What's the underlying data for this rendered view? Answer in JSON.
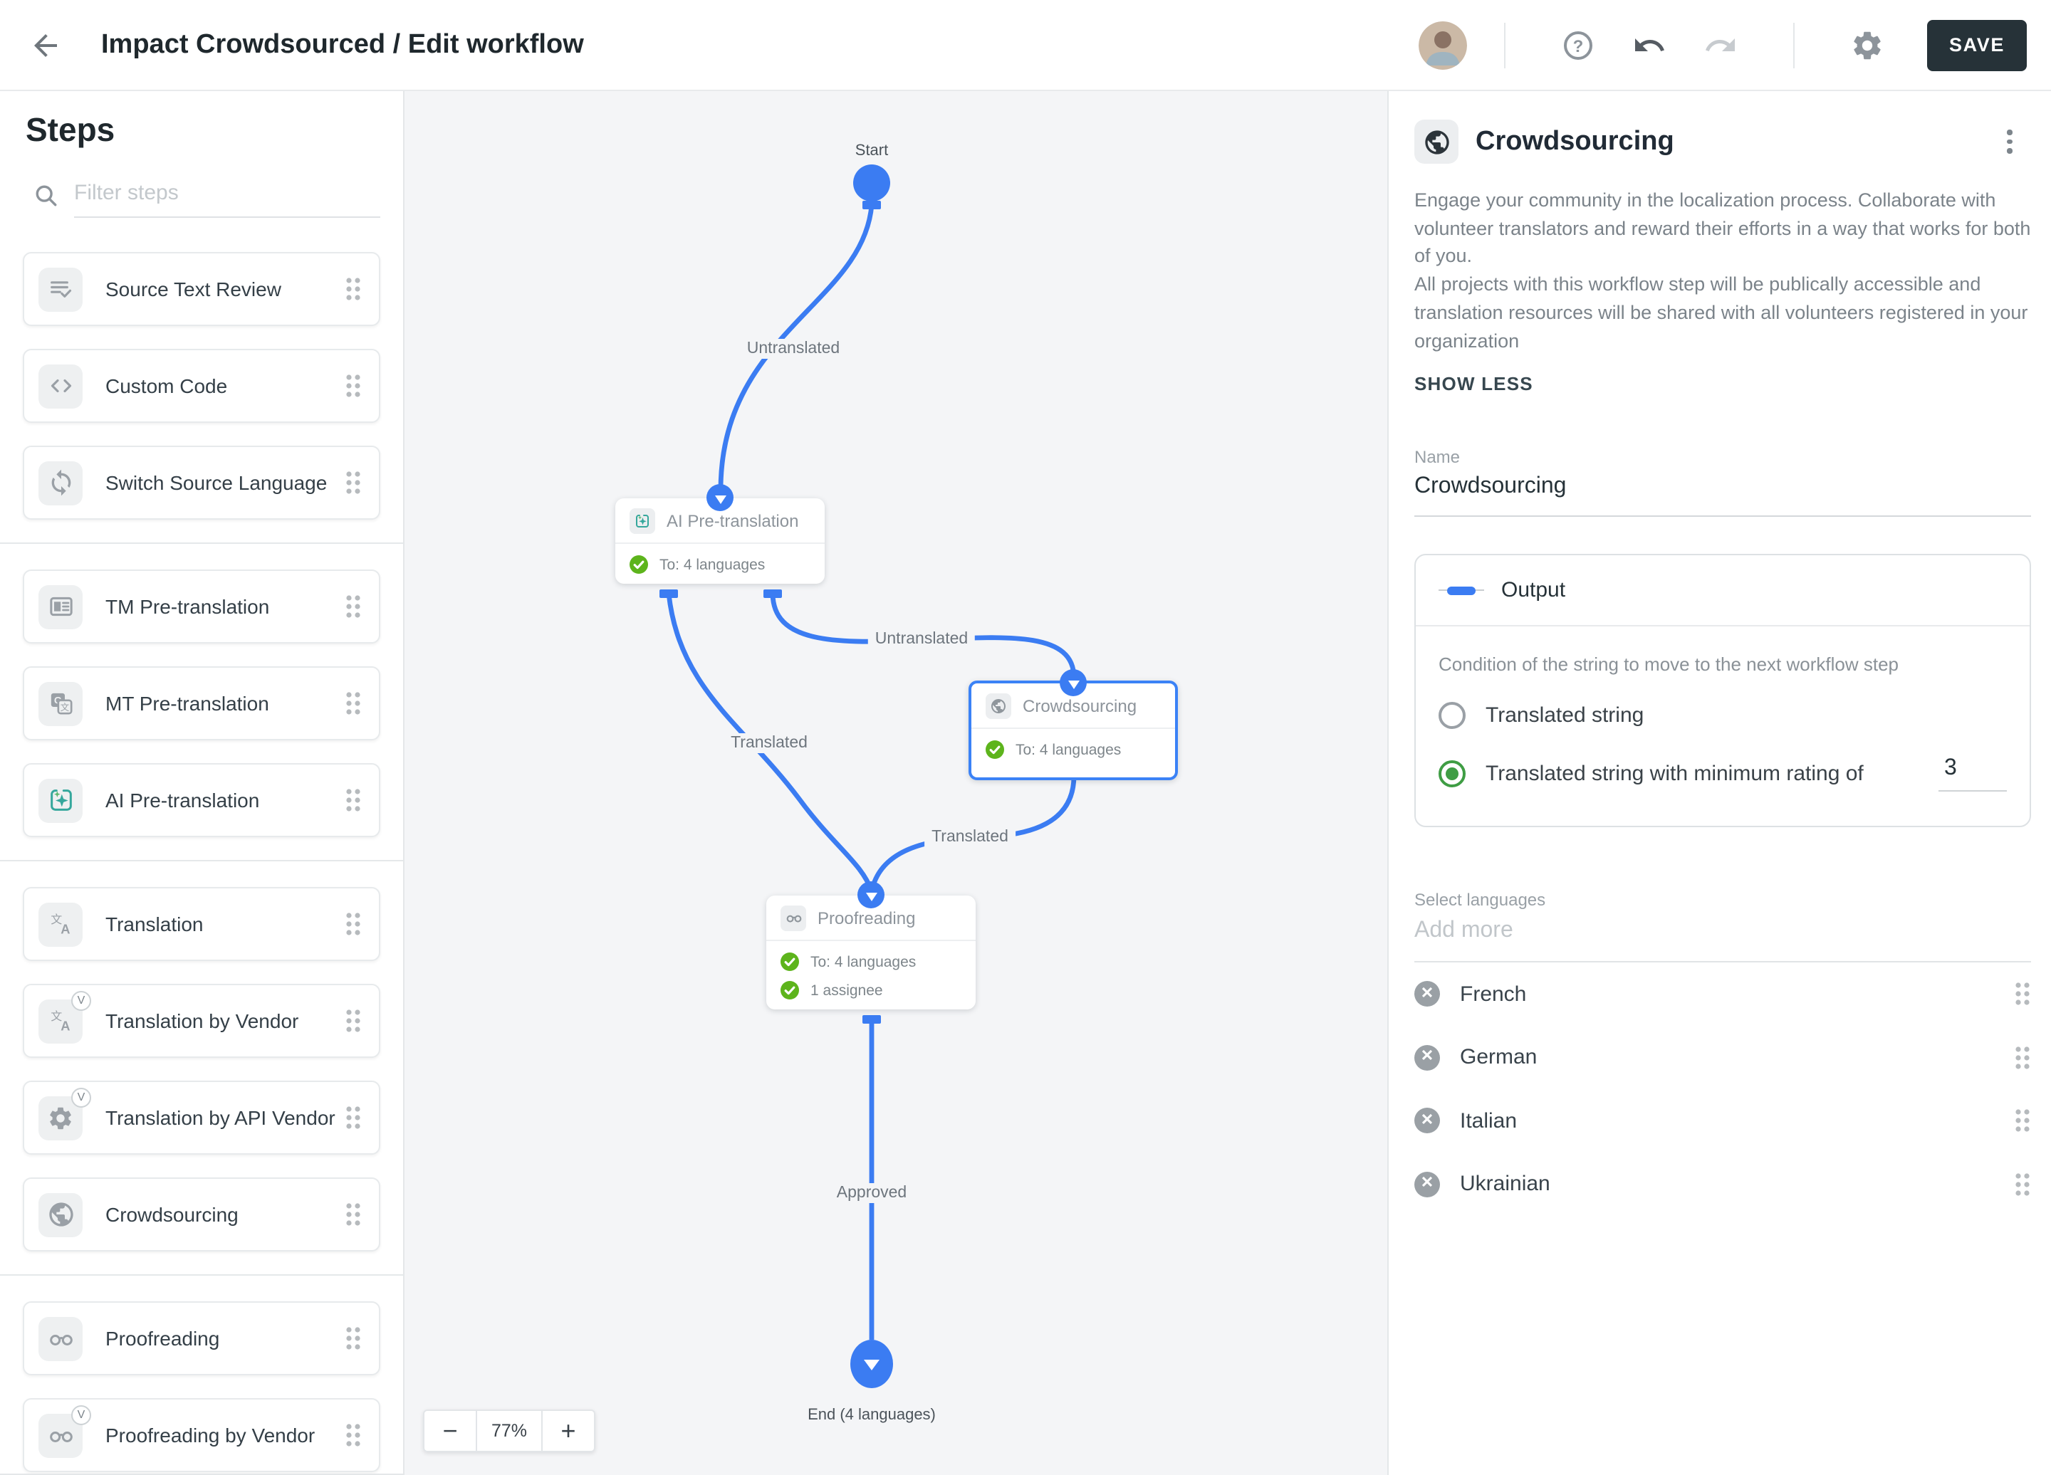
{
  "topbar": {
    "title": "Impact Crowdsourced / Edit workflow",
    "save_label": "SAVE"
  },
  "sidebar": {
    "title": "Steps",
    "filter_placeholder": "Filter steps",
    "groups": [
      {
        "items": [
          {
            "label": "Source Text Review",
            "icon": "source-text-review"
          },
          {
            "label": "Custom Code",
            "icon": "code"
          },
          {
            "label": "Switch Source Language",
            "icon": "sync"
          }
        ]
      },
      {
        "items": [
          {
            "label": "TM Pre-translation",
            "icon": "tm-card"
          },
          {
            "label": "MT Pre-translation",
            "icon": "mt-translate"
          },
          {
            "label": "AI Pre-translation",
            "icon": "ai-sparkle"
          }
        ]
      },
      {
        "items": [
          {
            "label": "Translation",
            "icon": "translate"
          },
          {
            "label": "Translation by Vendor",
            "icon": "translate",
            "vendor": "V"
          },
          {
            "label": "Translation by API Vendor",
            "icon": "gear",
            "vendor": "V"
          },
          {
            "label": "Crowdsourcing",
            "icon": "globe"
          }
        ]
      },
      {
        "items": [
          {
            "label": "Proofreading",
            "icon": "glasses"
          },
          {
            "label": "Proofreading by Vendor",
            "icon": "glasses",
            "vendor": "V"
          }
        ]
      }
    ]
  },
  "canvas": {
    "start_label": "Start",
    "end_label": "End (4 languages)",
    "zoom": {
      "out": "−",
      "level": "77%",
      "in": "+"
    },
    "edges": {
      "start_to_ai": "Untranslated",
      "ai_to_crowdsourcing": "Untranslated",
      "ai_to_proofreading": "Translated",
      "crowdsourcing_to_proofreading": "Translated",
      "proofreading_to_end": "Approved"
    },
    "nodes": [
      {
        "title": "AI Pre-translation",
        "rows": [
          "To: 4 languages"
        ]
      },
      {
        "title": "Crowdsourcing",
        "rows": [
          "To: 4 languages"
        ],
        "selected": true
      },
      {
        "title": "Proofreading",
        "rows": [
          "To: 4 languages",
          "1 assignee"
        ]
      }
    ]
  },
  "panel": {
    "title": "Crowdsourcing",
    "description": [
      "Engage your community in the localization process. Collaborate with volunteer translators and reward their efforts in a way that works for both of you.",
      "All projects with this workflow step will be publically accessible and translation resources will be shared with all volunteers registered in your organization"
    ],
    "show_less": "SHOW LESS",
    "name": {
      "label": "Name",
      "value": "Crowdsourcing"
    },
    "output": {
      "title": "Output",
      "condition": "Condition of the string to move to the next workflow step",
      "options": [
        {
          "label": "Translated string",
          "selected": false
        },
        {
          "label": "Translated string with minimum rating of",
          "selected": true,
          "value": "3"
        }
      ]
    },
    "languages": {
      "label": "Select languages",
      "placeholder": "Add more",
      "items": [
        "French",
        "German",
        "Italian",
        "Ukrainian"
      ]
    }
  },
  "colors": {
    "accent_blue": "#3b7cf2",
    "selected_border": "#3b82f6",
    "success_green": "#5db41c",
    "radio_green": "#3f9d44",
    "save_dark": "#263238",
    "canvas_bg": "#f4f5f7"
  }
}
